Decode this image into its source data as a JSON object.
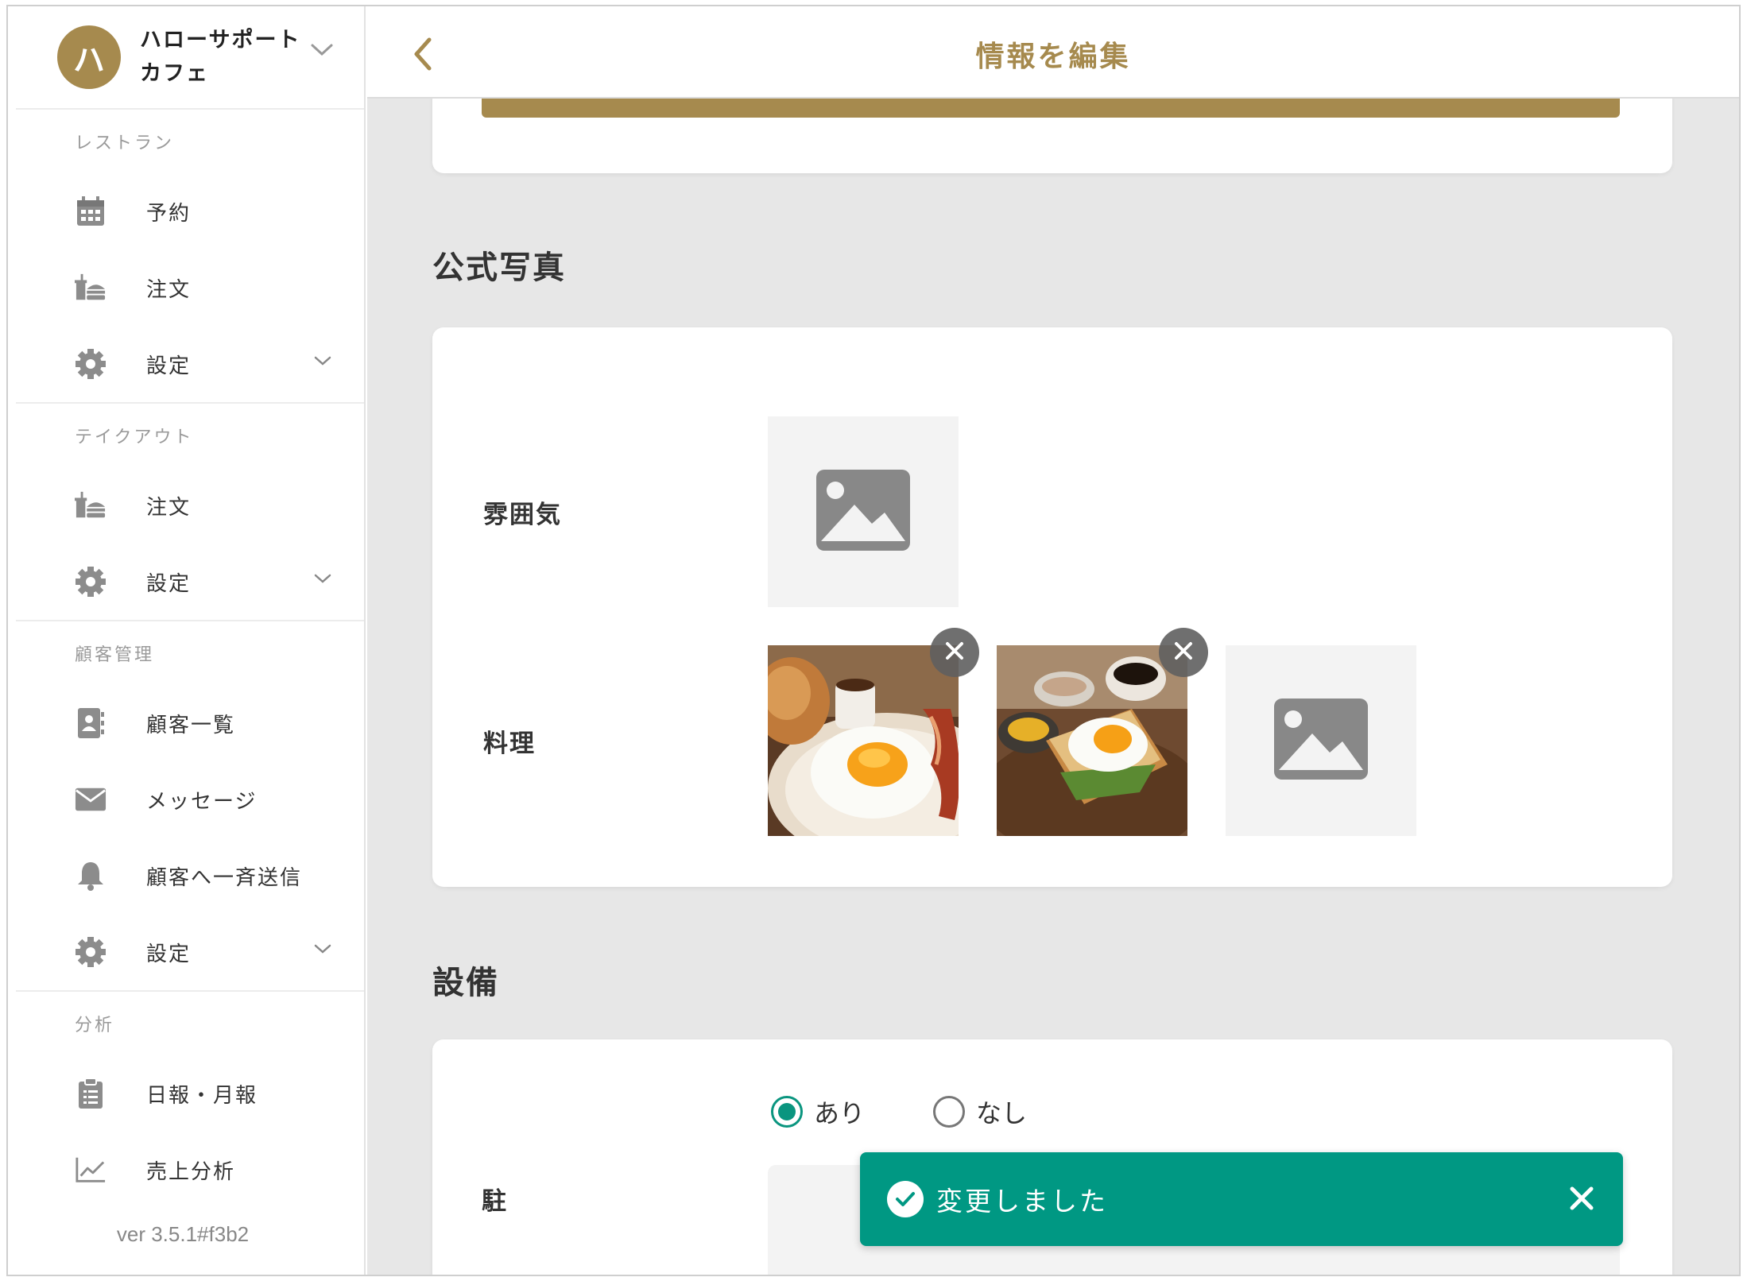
{
  "account": {
    "avatar_initial": "ハ",
    "name": "ハローサポートカフェ"
  },
  "sidebar": {
    "sections": [
      {
        "title": "レストラン",
        "items": [
          {
            "label": "予約",
            "icon": "calendar-icon"
          },
          {
            "label": "注文",
            "icon": "takeout-icon"
          },
          {
            "label": "設定",
            "icon": "gear-icon",
            "has_chevron": true
          }
        ]
      },
      {
        "title": "テイクアウト",
        "items": [
          {
            "label": "注文",
            "icon": "takeout-icon"
          },
          {
            "label": "設定",
            "icon": "gear-icon",
            "has_chevron": true
          }
        ]
      },
      {
        "title": "顧客管理",
        "items": [
          {
            "label": "顧客一覧",
            "icon": "contact-card-icon"
          },
          {
            "label": "メッセージ",
            "icon": "envelope-icon"
          },
          {
            "label": "顧客へ一斉送信",
            "icon": "bell-icon"
          },
          {
            "label": "設定",
            "icon": "gear-icon",
            "has_chevron": true
          }
        ]
      },
      {
        "title": "分析",
        "items": [
          {
            "label": "日報・月報",
            "icon": "clipboard-icon"
          },
          {
            "label": "売上分析",
            "icon": "line-chart-icon"
          }
        ]
      }
    ],
    "version": "ver 3.5.1#f3b2"
  },
  "header": {
    "title": "情報を編集"
  },
  "photos_section": {
    "heading": "公式写真",
    "rows": [
      {
        "label": "雰囲気"
      },
      {
        "label": "料理"
      }
    ]
  },
  "equipment_section": {
    "heading": "設備",
    "radio_options": [
      "あり",
      "なし"
    ],
    "selected": "あり",
    "partial_label": "駐"
  },
  "toast": {
    "message": "変更しました"
  },
  "colors": {
    "brand_gold": "#a68a4e",
    "success_green": "#009883",
    "background": "#e7e7e7"
  }
}
